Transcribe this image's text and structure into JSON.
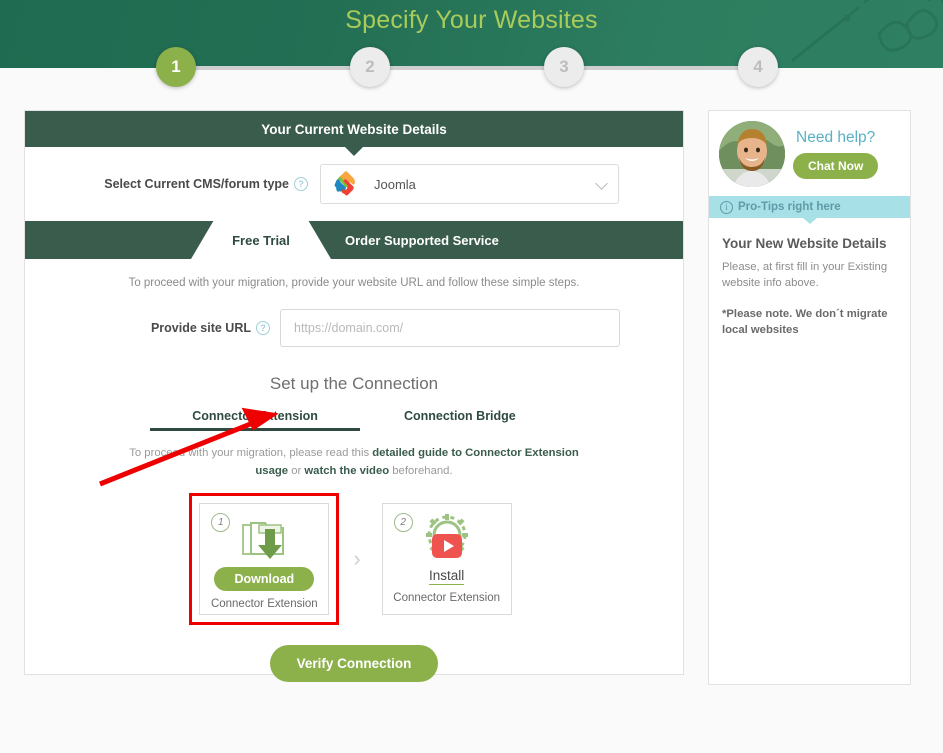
{
  "header": {
    "title": "Specify Your Websites",
    "accent": "#a9cb5a",
    "background": "#237054"
  },
  "stepper": {
    "active_step": "1",
    "steps": [
      {
        "label": "1",
        "state": "active"
      },
      {
        "label": "2",
        "state": "idle"
      },
      {
        "label": "3",
        "state": "idle"
      },
      {
        "label": "4",
        "state": "idle"
      }
    ]
  },
  "main": {
    "panel_title": "Your Current Website Details",
    "cms": {
      "label": "Select Current CMS/forum type",
      "help": "?",
      "selected": "Joomla",
      "icon": "joomla-logo"
    },
    "tabs": [
      {
        "label": "Free Trial",
        "selected": true
      },
      {
        "label": "Order Supported Service",
        "selected": false
      }
    ],
    "trial": {
      "hint": "To proceed with your migration, provide your website URL and follow these simple steps.",
      "url_label": "Provide site URL",
      "url_help": "?",
      "url_value": "",
      "url_placeholder": "https://domain.com/",
      "setup_title": "Set up the Connection",
      "connection_tabs": [
        {
          "label": "Connector Extension",
          "selected": true
        },
        {
          "label": "Connection Bridge",
          "selected": false
        }
      ],
      "guide_prefix": "To proceed with your migration, please read this ",
      "guide_link_1": "detailed guide to Connector Extension usage",
      "guide_middle": " or ",
      "guide_link_2": "watch the video",
      "guide_suffix": " beforehand.",
      "tiles": [
        {
          "number": "1",
          "icon": "download-folder-icon",
          "action_label": "Download",
          "action_type": "button",
          "caption": "Connector Extension",
          "highlighted": true
        },
        {
          "number": "2",
          "icon": "gear-play-install-icon",
          "action_label": "Install",
          "action_type": "link",
          "caption": "Connector Extension",
          "highlighted": false
        }
      ],
      "tile_separator": "›",
      "verify_label": "Verify Connection"
    }
  },
  "sidebar": {
    "avatar": "support-agent-photo",
    "need_help": "Need help?",
    "chat_label": "Chat Now",
    "protips": {
      "icon": "info-icon",
      "label": "Pro-Tips right here",
      "background": "#a8e0e8"
    },
    "heading": "Your New Website Details",
    "paragraph": "Please, at first fill in your Existing website info above.",
    "note": "*Please note. We don´t migrate local websites"
  },
  "annotations": {
    "arrow_color": "#ee0000",
    "highlight_color": "#ee0000"
  }
}
